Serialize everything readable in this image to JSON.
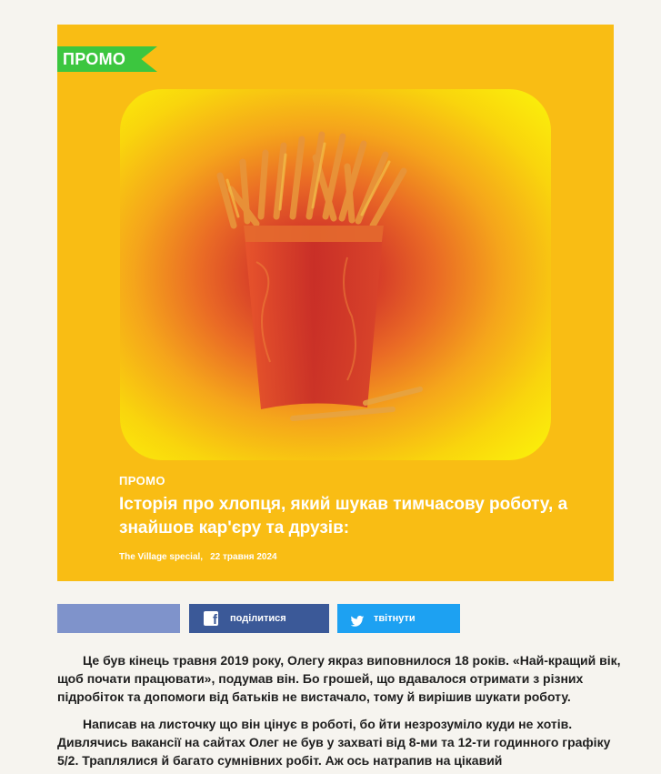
{
  "hero": {
    "flag_label": "ПРОМО",
    "kicker": "ПРОМО",
    "title": "Історія про хлопця, який шукав тимчасову роботу, а знайшов кар'єру та друзів:",
    "source": "The Village special,",
    "date": "22 травня 2024"
  },
  "share": {
    "facebook_label": "поділитися",
    "twitter_label": "твітнути"
  },
  "article": {
    "paragraphs": [
      "Це був кінець травня 2019 року, Олегу якраз виповнилося 18 років. «Най-кращий вік, щоб почати працювати», подумав він. Бо грошей, що вдавалося отримати з різних підробіток та допомоги від батьків не вистачало, тому й вирішив шукати роботу.",
      "Написав на листочку що він цінує в роботі, бо йти незрозуміло куди не хотів. Дивлячись вакансії на сайтах Олег не був у захваті від 8-ми та 12-ти годинного графіку 5/2. Траплялися й багато сумнівних робіт. Аж ось натрапив на цікавий"
    ]
  },
  "colors": {
    "hero_bg": "#f9bd14",
    "flag_green": "#3cc63f",
    "facebook_blue": "#3b5998",
    "twitter_blue": "#1da1f2"
  },
  "icons": [
    "fries-illustration",
    "facebook-icon",
    "twitter-bird-icon"
  ]
}
